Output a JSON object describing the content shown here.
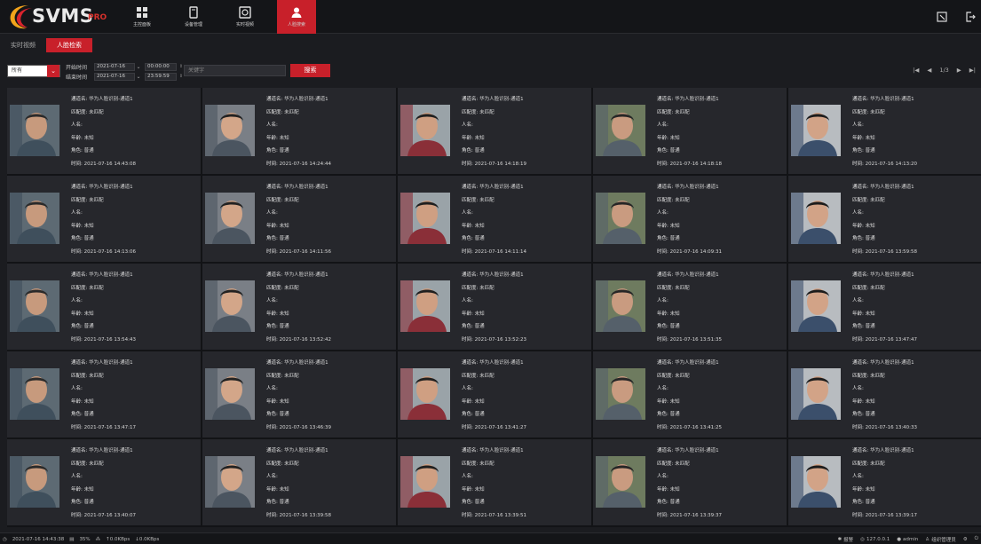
{
  "app": {
    "logo_text": "SVMS",
    "logo_suffix": "PRO"
  },
  "nav": [
    {
      "label": "主控面板",
      "icon": "dashboard-icon"
    },
    {
      "label": "设备管理",
      "icon": "device-icon"
    },
    {
      "label": "实时视频",
      "icon": "video-icon"
    },
    {
      "label": "人脸搜索",
      "icon": "face-search-icon",
      "active": true
    }
  ],
  "subtabs": [
    {
      "label": "实时视频"
    },
    {
      "label": "人脸检索",
      "active": true
    }
  ],
  "filters": {
    "select_value": "所有",
    "start_label": "开始时间",
    "start_date": "2021-07-16",
    "start_time": "00:00:00",
    "end_label": "结束时间",
    "end_date": "2021-07-16",
    "end_time": "23:59:59",
    "keyword_placeholder": "关键字",
    "search_label": "搜索"
  },
  "pager": {
    "first": "|◀",
    "prev": "◀",
    "page": "1/3",
    "next": "▶",
    "last": "▶|"
  },
  "field_labels": {
    "channel": "通道名:",
    "match": "匹配度:",
    "name": "人名:",
    "age": "年龄:",
    "role": "角色:",
    "time": "时间:"
  },
  "results": [
    {
      "channel": "华为人脸识别-通道1",
      "match": "未匹配",
      "name": "",
      "age": "未知",
      "role": "普通",
      "time": "2021-07-16 14:43:08"
    },
    {
      "channel": "华为人脸识别-通道1",
      "match": "未匹配",
      "name": "",
      "age": "未知",
      "role": "普通",
      "time": "2021-07-16 14:24:44"
    },
    {
      "channel": "华为人脸识别-通道1",
      "match": "未匹配",
      "name": "",
      "age": "未知",
      "role": "普通",
      "time": "2021-07-16 14:18:19"
    },
    {
      "channel": "华为人脸识别-通道1",
      "match": "未匹配",
      "name": "",
      "age": "未知",
      "role": "普通",
      "time": "2021-07-16 14:18:18"
    },
    {
      "channel": "华为人脸识别-通道1",
      "match": "未匹配",
      "name": "",
      "age": "未知",
      "role": "普通",
      "time": "2021-07-16 14:13:20"
    },
    {
      "channel": "华为人脸识别-通道1",
      "match": "未匹配",
      "name": "",
      "age": "未知",
      "role": "普通",
      "time": "2021-07-16 14:13:06"
    },
    {
      "channel": "华为人脸识别-通道1",
      "match": "未匹配",
      "name": "",
      "age": "未知",
      "role": "普通",
      "time": "2021-07-16 14:11:56"
    },
    {
      "channel": "华为人脸识别-通道1",
      "match": "未匹配",
      "name": "",
      "age": "未知",
      "role": "普通",
      "time": "2021-07-16 14:11:14"
    },
    {
      "channel": "华为人脸识别-通道1",
      "match": "未匹配",
      "name": "",
      "age": "未知",
      "role": "普通",
      "time": "2021-07-16 14:09:31"
    },
    {
      "channel": "华为人脸识别-通道1",
      "match": "未匹配",
      "name": "",
      "age": "未知",
      "role": "普通",
      "time": "2021-07-16 13:59:58"
    },
    {
      "channel": "华为人脸识别-通道1",
      "match": "未匹配",
      "name": "",
      "age": "未知",
      "role": "普通",
      "time": "2021-07-16 13:54:43"
    },
    {
      "channel": "华为人脸识别-通道1",
      "match": "未匹配",
      "name": "",
      "age": "未知",
      "role": "普通",
      "time": "2021-07-16 13:52:42"
    },
    {
      "channel": "华为人脸识别-通道1",
      "match": "未匹配",
      "name": "",
      "age": "未知",
      "role": "普通",
      "time": "2021-07-16 13:52:23"
    },
    {
      "channel": "华为人脸识别-通道1",
      "match": "未匹配",
      "name": "",
      "age": "未知",
      "role": "普通",
      "time": "2021-07-16 13:51:35"
    },
    {
      "channel": "华为人脸识别-通道1",
      "match": "未匹配",
      "name": "",
      "age": "未知",
      "role": "普通",
      "time": "2021-07-16 13:47:47"
    },
    {
      "channel": "华为人脸识别-通道1",
      "match": "未匹配",
      "name": "",
      "age": "未知",
      "role": "普通",
      "time": "2021-07-16 13:47:17"
    },
    {
      "channel": "华为人脸识别-通道1",
      "match": "未匹配",
      "name": "",
      "age": "未知",
      "role": "普通",
      "time": "2021-07-16 13:46:39"
    },
    {
      "channel": "华为人脸识别-通道1",
      "match": "未匹配",
      "name": "",
      "age": "未知",
      "role": "普通",
      "time": "2021-07-16 13:41:27"
    },
    {
      "channel": "华为人脸识别-通道1",
      "match": "未匹配",
      "name": "",
      "age": "未知",
      "role": "普通",
      "time": "2021-07-16 13:41:25"
    },
    {
      "channel": "华为人脸识别-通道1",
      "match": "未匹配",
      "name": "",
      "age": "未知",
      "role": "普通",
      "time": "2021-07-16 13:40:33"
    },
    {
      "channel": "华为人脸识别-通道1",
      "match": "未匹配",
      "name": "",
      "age": "未知",
      "role": "普通",
      "time": "2021-07-16 13:40:07"
    },
    {
      "channel": "华为人脸识别-通道1",
      "match": "未匹配",
      "name": "",
      "age": "未知",
      "role": "普通",
      "time": "2021-07-16 13:39:58"
    },
    {
      "channel": "华为人脸识别-通道1",
      "match": "未匹配",
      "name": "",
      "age": "未知",
      "role": "普通",
      "time": "2021-07-16 13:39:51"
    },
    {
      "channel": "华为人脸识别-通道1",
      "match": "未匹配",
      "name": "",
      "age": "未知",
      "role": "普通",
      "time": "2021-07-16 13:39:37"
    },
    {
      "channel": "华为人脸识别-通道1",
      "match": "未匹配",
      "name": "",
      "age": "未知",
      "role": "普通",
      "time": "2021-07-16 13:39:17"
    }
  ],
  "status": {
    "datetime": "2021-07-16 14:43:38",
    "cpu": "35%",
    "net_up": "↑0.0KBps",
    "net_down": "↓0.0KBps",
    "alarm": "报警",
    "ip": "127.0.0.1",
    "user": "admin",
    "org": "组织管理员"
  },
  "colors": {
    "accent": "#c8202a",
    "background": "#1b1c20",
    "card": "#26272c"
  }
}
